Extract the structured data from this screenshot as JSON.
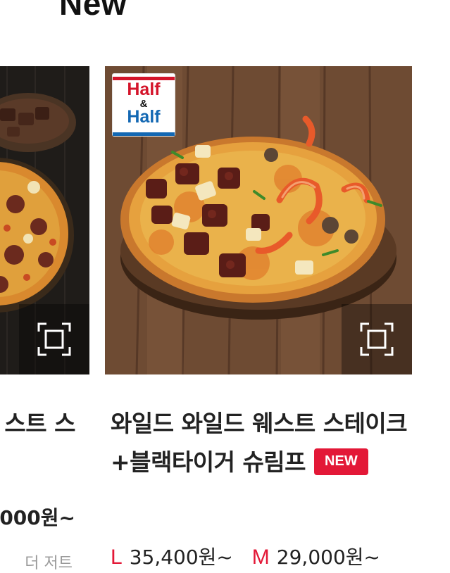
{
  "section": {
    "title": "New"
  },
  "colors": {
    "brand_red": "#e31837",
    "half_blue": "#1368b3",
    "text": "#222222"
  },
  "left_card": {
    "name_partial": "스트 스",
    "price_partial": "000원~",
    "desc_partial": "더 저트"
  },
  "main_card": {
    "badge": {
      "line1": "Half",
      "amp": "&",
      "line2": "Half"
    },
    "zoom_icon": "expand-icon",
    "name": "와일드 와일드 웨스트 스테이크+블랙타이거 슈림프",
    "new_badge": "NEW",
    "prices": [
      {
        "size": "L",
        "price": "35,400원~"
      },
      {
        "size": "M",
        "price": "29,000원~"
      }
    ]
  }
}
